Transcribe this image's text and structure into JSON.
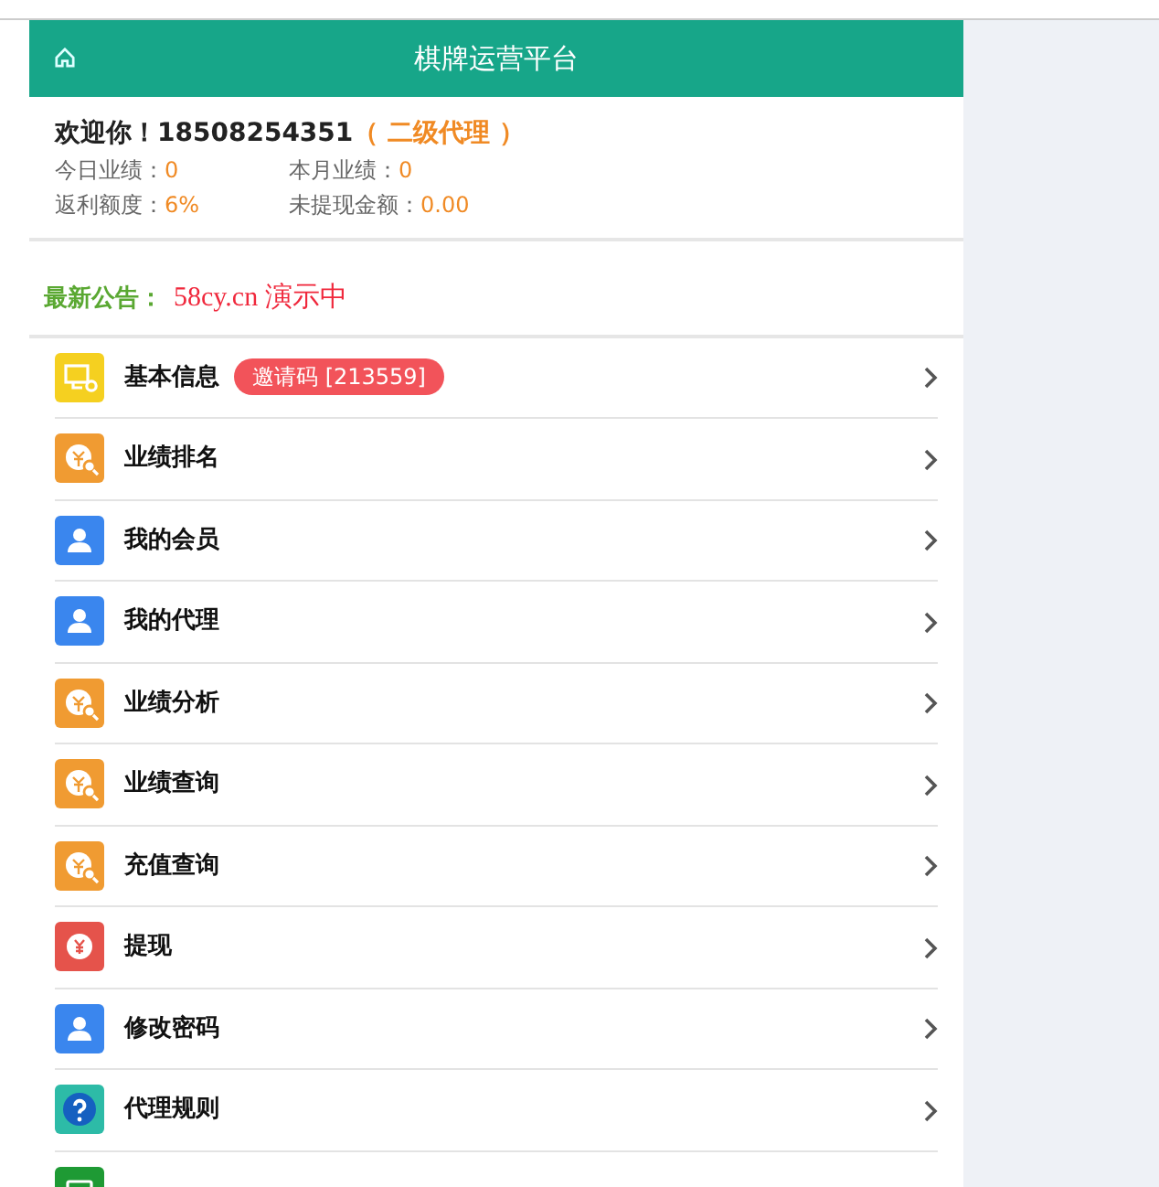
{
  "header": {
    "title": "棋牌运营平台"
  },
  "welcome": {
    "greeting": "欢迎你！18508254351",
    "level": "（ 二级代理 ）"
  },
  "stats": [
    {
      "label": "今日业绩：",
      "value": "0"
    },
    {
      "label": "本月业绩：",
      "value": "0"
    },
    {
      "label": "返利额度：",
      "value": "6%"
    },
    {
      "label": "未提现金额：",
      "value": "0.00"
    }
  ],
  "notice": {
    "label": "最新公告：",
    "text": "58cy.cn 演示中"
  },
  "menu": [
    {
      "kind": "monitor",
      "label": "基本信息",
      "badge": "邀请码 [213559]"
    },
    {
      "kind": "coin-search",
      "label": "业绩排名"
    },
    {
      "kind": "user",
      "label": "我的会员"
    },
    {
      "kind": "user",
      "label": "我的代理"
    },
    {
      "kind": "coin-search",
      "label": "业绩分析"
    },
    {
      "kind": "coin-search",
      "label": "业绩查询"
    },
    {
      "kind": "coin-search",
      "label": "充值查询"
    },
    {
      "kind": "yen",
      "label": "提现"
    },
    {
      "kind": "user",
      "label": "修改密码"
    },
    {
      "kind": "help",
      "label": "代理规则"
    },
    {
      "kind": "card"
    }
  ]
}
